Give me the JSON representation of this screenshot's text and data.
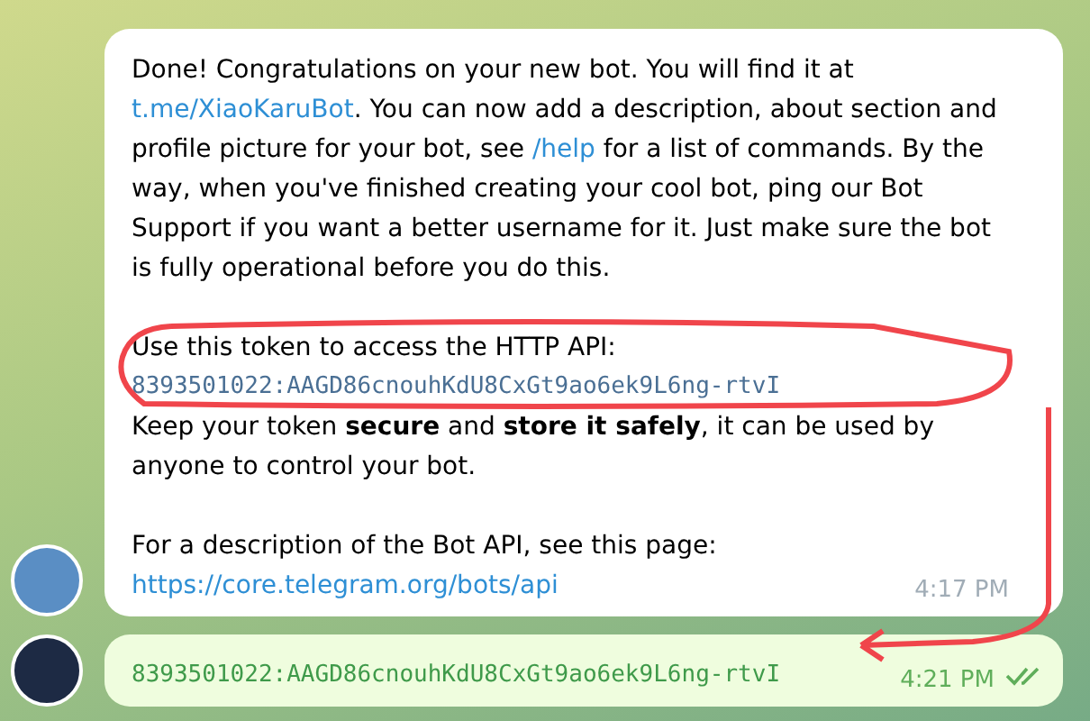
{
  "messages": [
    {
      "kind": "incoming",
      "paragraphs": [
        [
          {
            "kind": "text",
            "text": "Done! Congratulations on your new bot. You will find it at "
          },
          {
            "kind": "link",
            "text": "t.me/XiaoKaruBot"
          },
          {
            "kind": "text",
            "text": ". You can now add a description, about section and profile picture for your bot, see "
          },
          {
            "kind": "link",
            "text": "/help"
          },
          {
            "kind": "text",
            "text": " for a list of commands. By the way, when you've finished creating your cool bot, ping our Bot Support if you want a better username for it. Just make sure the bot is fully operational before you do this."
          }
        ],
        [
          {
            "kind": "text",
            "text": "Use this token to access the HTTP API:"
          },
          {
            "kind": "code",
            "text": "8393501022:AAGD86cnouhKdU8CxGt9ao6ek9L6ng-rtvI"
          },
          {
            "kind": "text",
            "text": "Keep your token **secure** and **store it safely**, it can be used by anyone to control your bot."
          }
        ],
        [
          {
            "kind": "text",
            "text": "For a description of the Bot API, see this page:"
          },
          {
            "kind": "link",
            "text": "https://core.telegram.org/bots/api"
          }
        ]
      ],
      "time": "4:17 PM"
    },
    {
      "kind": "outgoing",
      "paragraphs": [
        [
          {
            "kind": "code",
            "text": "8393501022:AAGD86cnouhKdU8CxGt9ao6ek9L6ng-rtvI"
          }
        ]
      ],
      "time": "4:21 PM",
      "read": true
    }
  ]
}
